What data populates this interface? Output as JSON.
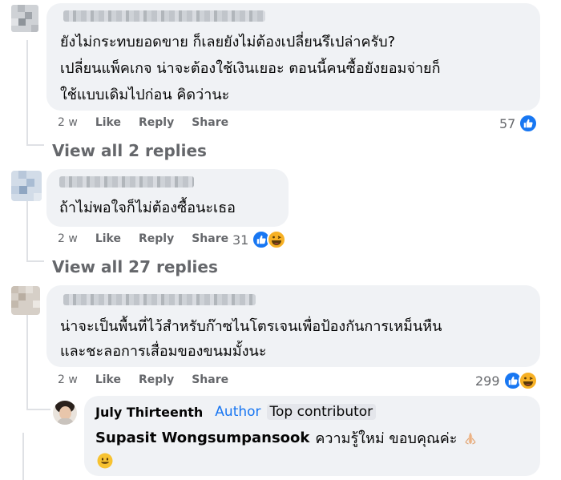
{
  "comments": [
    {
      "text_lines": [
        "ยังไม่กระทบยอดขาย ก็เลยยังไม่ต้องเปลี่ยนรึเปล่าครับ?",
        "เปลี่ยนแพ็คเกจ น่าจะต้องใช้เงินเยอะ ตอนนี้คนซื้อยังยอมจ่ายก็",
        "ใช้แบบเดิมไปก่อน คิดว่านะ"
      ],
      "time": "2 w",
      "like_label": "Like",
      "reply_label": "Reply",
      "share_label": "Share",
      "reaction_count": "57",
      "reaction_icons": [
        "like-icon"
      ],
      "view_replies": "View all 2 replies"
    },
    {
      "text_lines": [
        "ถ้าไม่พอใจก็ไม่ต้องซื้อนะเธอ"
      ],
      "time": "2 w",
      "like_label": "Like",
      "reply_label": "Reply",
      "share_label": "Share",
      "reaction_count": "31",
      "reaction_icons": [
        "like-icon",
        "haha-icon"
      ],
      "view_replies": "View all 27 replies"
    },
    {
      "text_lines": [
        "น่าจะเป็นพื้นที่ไว้สำหรับก๊าซไนโตรเจนเพื่อป้องกันการเหม็นหืน",
        "และชะลอการเสื่อมของขนมมั้งนะ"
      ],
      "time": "2 w",
      "like_label": "Like",
      "reply_label": "Reply",
      "share_label": "Share",
      "reaction_count": "299",
      "reaction_icons": [
        "like-icon",
        "haha-icon"
      ]
    }
  ],
  "reply": {
    "author_name": "July Thirteenth",
    "author_badge": "Author",
    "contributor_badge": "Top contributor",
    "mention": "Supasit Wongsumpansook",
    "text": "ความรู้ใหม่ ขอบคุณค่ะ",
    "emojis": [
      "folded-hands-icon",
      "smiling-face-icon"
    ]
  },
  "colors": {
    "bubble_bg": "#f0f2f5",
    "meta_text": "#65676b",
    "like_blue": "#1877f2",
    "author_blue": "#1876f2",
    "haha_yellow": "#f7b125"
  }
}
